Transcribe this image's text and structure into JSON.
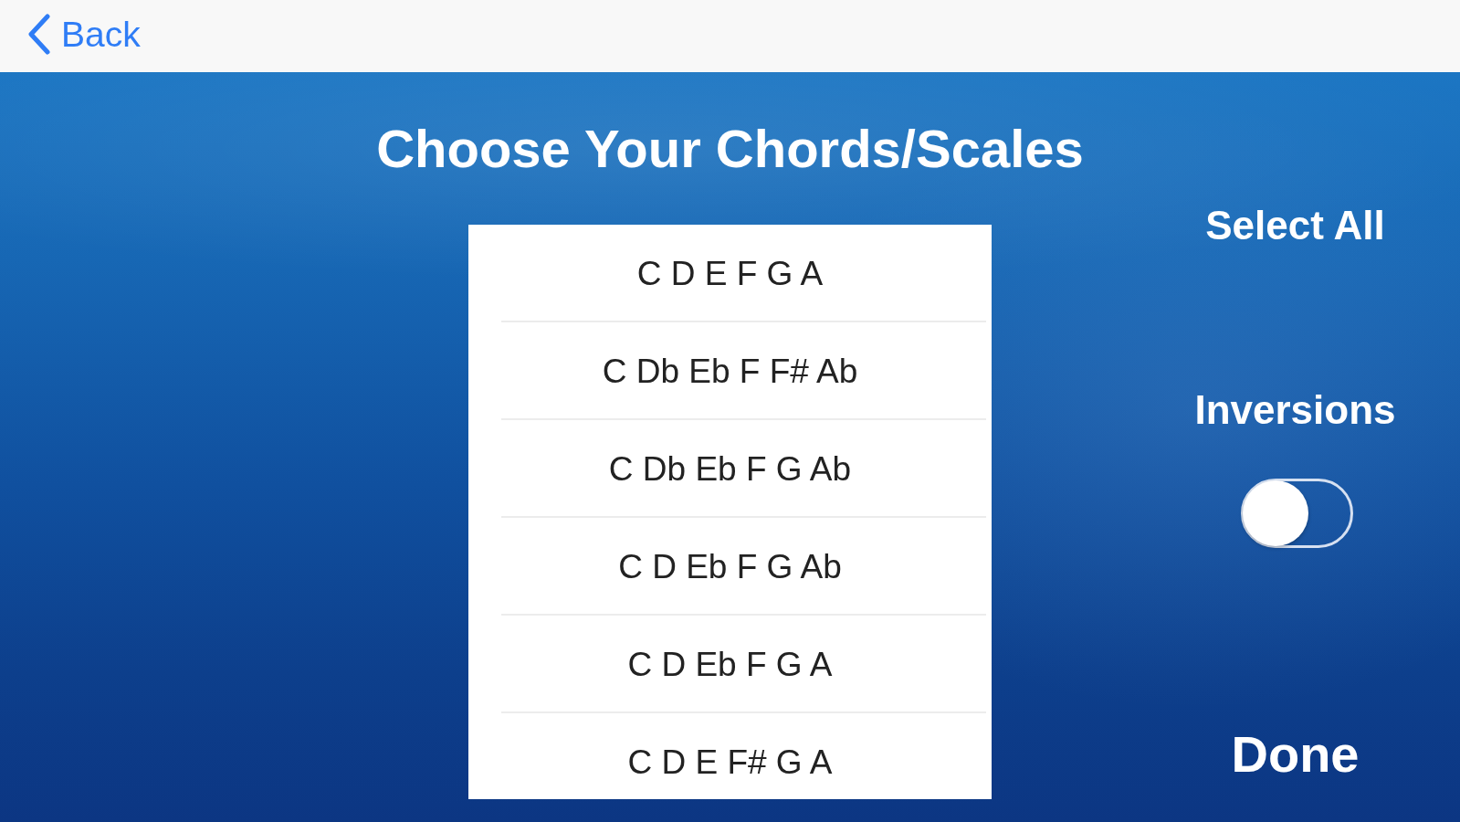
{
  "nav": {
    "back": "Back"
  },
  "title": "Choose Your Chords/Scales",
  "scales": [
    "C D E F G A",
    "C Db Eb F F# Ab",
    "C Db Eb F G Ab",
    "C D Eb F G Ab",
    "C D Eb F G A",
    "C D E F# G A"
  ],
  "select_all": "Select All",
  "inversions": {
    "label": "Inversions",
    "on": false
  },
  "done": "Done"
}
